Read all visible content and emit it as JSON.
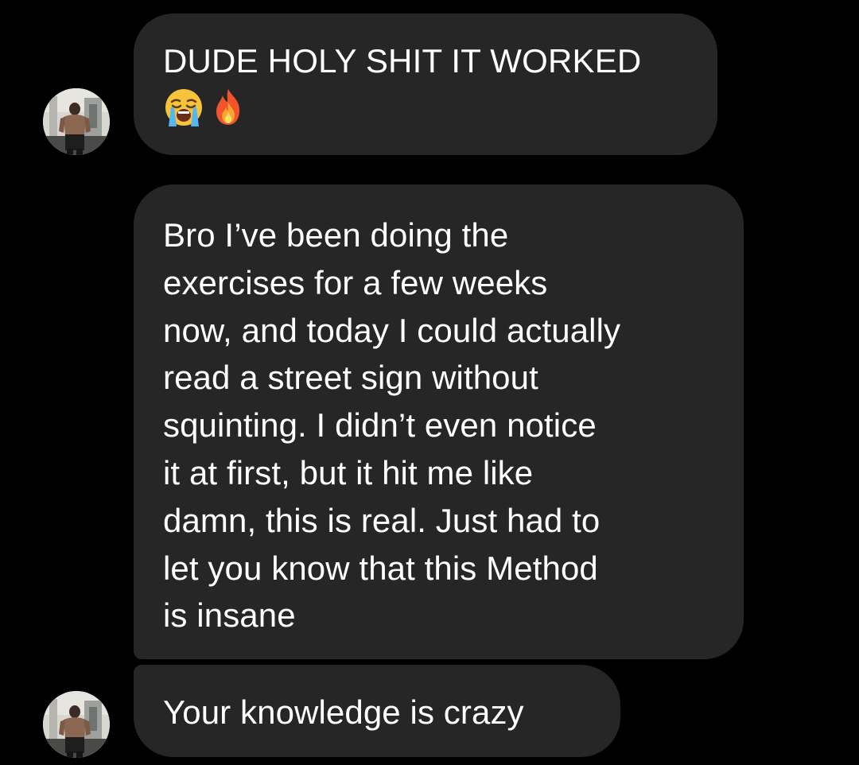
{
  "conversation": {
    "messages": [
      {
        "text": "DUDE HOLY SHIT IT WORKED",
        "emojis": [
          "loudly-crying-face-emoji",
          "fire-emoji"
        ]
      },
      {
        "text": "Bro I’ve been doing the\nexercises for a few weeks\nnow, and today I could actually\nread a street sign without\nsquinting. I didn’t even notice\nit at first, but it hit me like\ndamn, this is real. Just had to\nlet you know that this Method\nis insane"
      },
      {
        "text": "Your knowledge is crazy"
      }
    ],
    "sender_avatar": "profile-photo-avatar"
  },
  "colors": {
    "background": "#000000",
    "bubble": "#262626",
    "text": "#ffffff"
  }
}
